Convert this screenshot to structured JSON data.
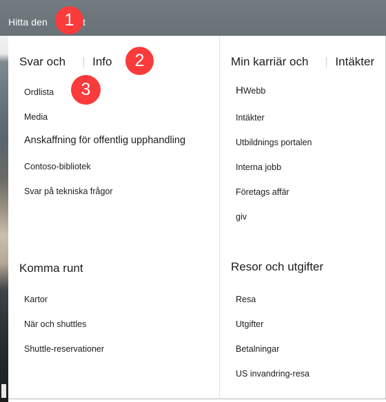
{
  "topbar": {
    "title": "Hitta den",
    "title_tail": "t"
  },
  "columns": {
    "left": {
      "groups": [
        {
          "heading_primary": "Svar och",
          "heading_secondary": "Info",
          "links": [
            "Ordlista",
            "Media",
            "Anskaffning för offentlig upphandling",
            "Contoso-bibliotek",
            "Svar på tekniska frågor"
          ]
        },
        {
          "heading_primary": "Komma runt",
          "heading_secondary": "",
          "links": [
            "Kartor",
            "När och shuttles",
            "Shuttle-reservationer"
          ]
        }
      ]
    },
    "right": {
      "groups": [
        {
          "heading_primary": "Min karriär och",
          "heading_secondary": "Intäkter",
          "links": [
            "HWebb",
            "Intäkter",
            "Utbildnings portalen",
            "Interna jobb",
            "Företags affär",
            "giv"
          ],
          "first_link_parts": {
            "cap": "H",
            "rest": "Webb"
          }
        },
        {
          "heading_primary": "Resor och utgifter",
          "heading_secondary": "",
          "links": [
            "Resa",
            "Utgifter",
            "Betalningar",
            "US invandring-resa"
          ]
        }
      ]
    }
  },
  "callouts": [
    {
      "number": "1"
    },
    {
      "number": "2"
    },
    {
      "number": "3"
    }
  ],
  "colors": {
    "topbar": "#6a7479",
    "badge": "#f93b3b",
    "text": "#1c1c1c",
    "divider": "#e2e2e2"
  }
}
